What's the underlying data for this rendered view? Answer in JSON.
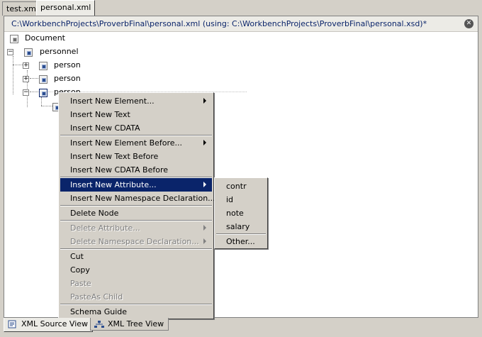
{
  "top_tabs": [
    {
      "label": "test.xml",
      "active": false
    },
    {
      "label": "personal.xml",
      "active": true
    }
  ],
  "path_bar": {
    "text": "C:\\WorkbenchProjects\\ProverbFinal\\personal.xml (using: C:\\WorkbenchProjects\\ProverbFinal\\personal.xsd)*"
  },
  "icons": {
    "close": "close-icon",
    "expander_plus": "plus-icon",
    "expander_minus": "minus-icon",
    "element": "element-node-icon",
    "document": "document-node-icon",
    "submenu": "chevron-right-icon"
  },
  "tree": {
    "document": "Document",
    "root": "personnel",
    "children": [
      "person",
      "person",
      "person"
    ]
  },
  "context_menu": {
    "items": [
      {
        "label": "Insert New Element...",
        "submenu": true,
        "enabled": true,
        "selected": false
      },
      {
        "label": "Insert New Text",
        "submenu": false,
        "enabled": true,
        "selected": false
      },
      {
        "label": "Insert New CDATA",
        "submenu": false,
        "enabled": true,
        "selected": false
      },
      {
        "label": "Insert New Element Before...",
        "submenu": true,
        "enabled": true,
        "selected": false
      },
      {
        "label": "Insert New Text Before",
        "submenu": false,
        "enabled": true,
        "selected": false
      },
      {
        "label": "Insert New CDATA Before",
        "submenu": false,
        "enabled": true,
        "selected": false
      },
      {
        "label": "Insert New Attribute...",
        "submenu": true,
        "enabled": true,
        "selected": true
      },
      {
        "label": "Insert New Namespace Declaration...",
        "submenu": false,
        "enabled": true,
        "selected": false
      },
      {
        "label": "Delete Node",
        "submenu": false,
        "enabled": true,
        "selected": false
      },
      {
        "label": "Delete Attribute...",
        "submenu": true,
        "enabled": false,
        "selected": false
      },
      {
        "label": "Delete Namespace Declaration...",
        "submenu": true,
        "enabled": false,
        "selected": false
      },
      {
        "label": "Cut",
        "submenu": false,
        "enabled": true,
        "selected": false
      },
      {
        "label": "Copy",
        "submenu": false,
        "enabled": true,
        "selected": false
      },
      {
        "label": "Paste",
        "submenu": false,
        "enabled": false,
        "selected": false
      },
      {
        "label": "PasteAs Child",
        "submenu": false,
        "enabled": false,
        "selected": false
      },
      {
        "label": "Schema Guide",
        "submenu": false,
        "enabled": true,
        "selected": false
      }
    ]
  },
  "attribute_submenu": {
    "items": [
      "contr",
      "id",
      "note",
      "salary",
      "Other..."
    ]
  },
  "bottom_tabs": [
    {
      "label": "XML Source View",
      "active": true,
      "icon": "source-view-icon"
    },
    {
      "label": "XML Tree View",
      "active": false,
      "icon": "tree-view-icon"
    }
  ],
  "colors": {
    "selection": "#0a246a",
    "path_text": "#0a246a",
    "chrome": "#d4d0c8"
  }
}
